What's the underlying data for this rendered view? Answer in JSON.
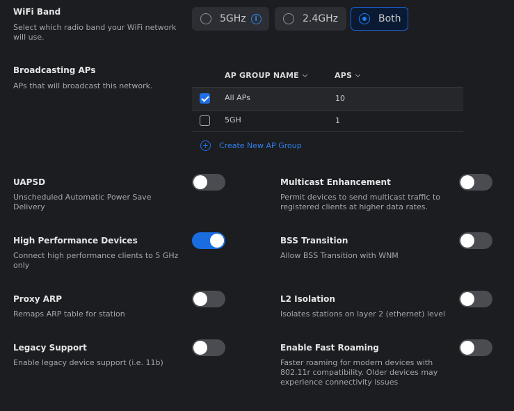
{
  "wifi_band": {
    "title": "WiFi Band",
    "description": "Select which radio band your WiFi network will use.",
    "options": [
      {
        "label": "5GHz",
        "selected": false,
        "has_info": true
      },
      {
        "label": "2.4GHz",
        "selected": false
      },
      {
        "label": "Both",
        "selected": true
      }
    ]
  },
  "broadcasting": {
    "title": "Broadcasting APs",
    "description": "APs that will broadcast this network.",
    "columns": [
      "AP GROUP NAME",
      "APS"
    ],
    "rows": [
      {
        "name": "All APs",
        "aps": "10",
        "checked": true
      },
      {
        "name": "5GH",
        "aps": "1",
        "checked": false
      }
    ],
    "create_label": "Create New AP Group"
  },
  "settings": [
    {
      "title": "UAPSD",
      "description": "Unscheduled Automatic Power Save Delivery",
      "enabled": false
    },
    {
      "title": "Multicast Enhancement",
      "description": "Permit devices to send multicast traffic to registered clients at higher data rates.",
      "enabled": false
    },
    {
      "title": "High Performance Devices",
      "description": "Connect high performance clients to 5 GHz only",
      "enabled": true
    },
    {
      "title": "BSS Transition",
      "description": "Allow BSS Transition with WNM",
      "enabled": false
    },
    {
      "title": "Proxy ARP",
      "description": "Remaps ARP table for station",
      "enabled": false
    },
    {
      "title": "L2 Isolation",
      "description": "Isolates stations on layer 2 (ethernet) level",
      "enabled": false
    },
    {
      "title": "Legacy Support",
      "description": "Enable legacy device support (i.e. 11b)",
      "enabled": false
    },
    {
      "title": "Enable Fast Roaming",
      "description": "Faster roaming for modern devices with 802.11r compatibility. Older devices may experience connectivity issues",
      "enabled": false
    }
  ],
  "colors": {
    "background": "#1c1d20",
    "accent": "#1f6ee6",
    "toggle_off": "#4a4c51"
  }
}
